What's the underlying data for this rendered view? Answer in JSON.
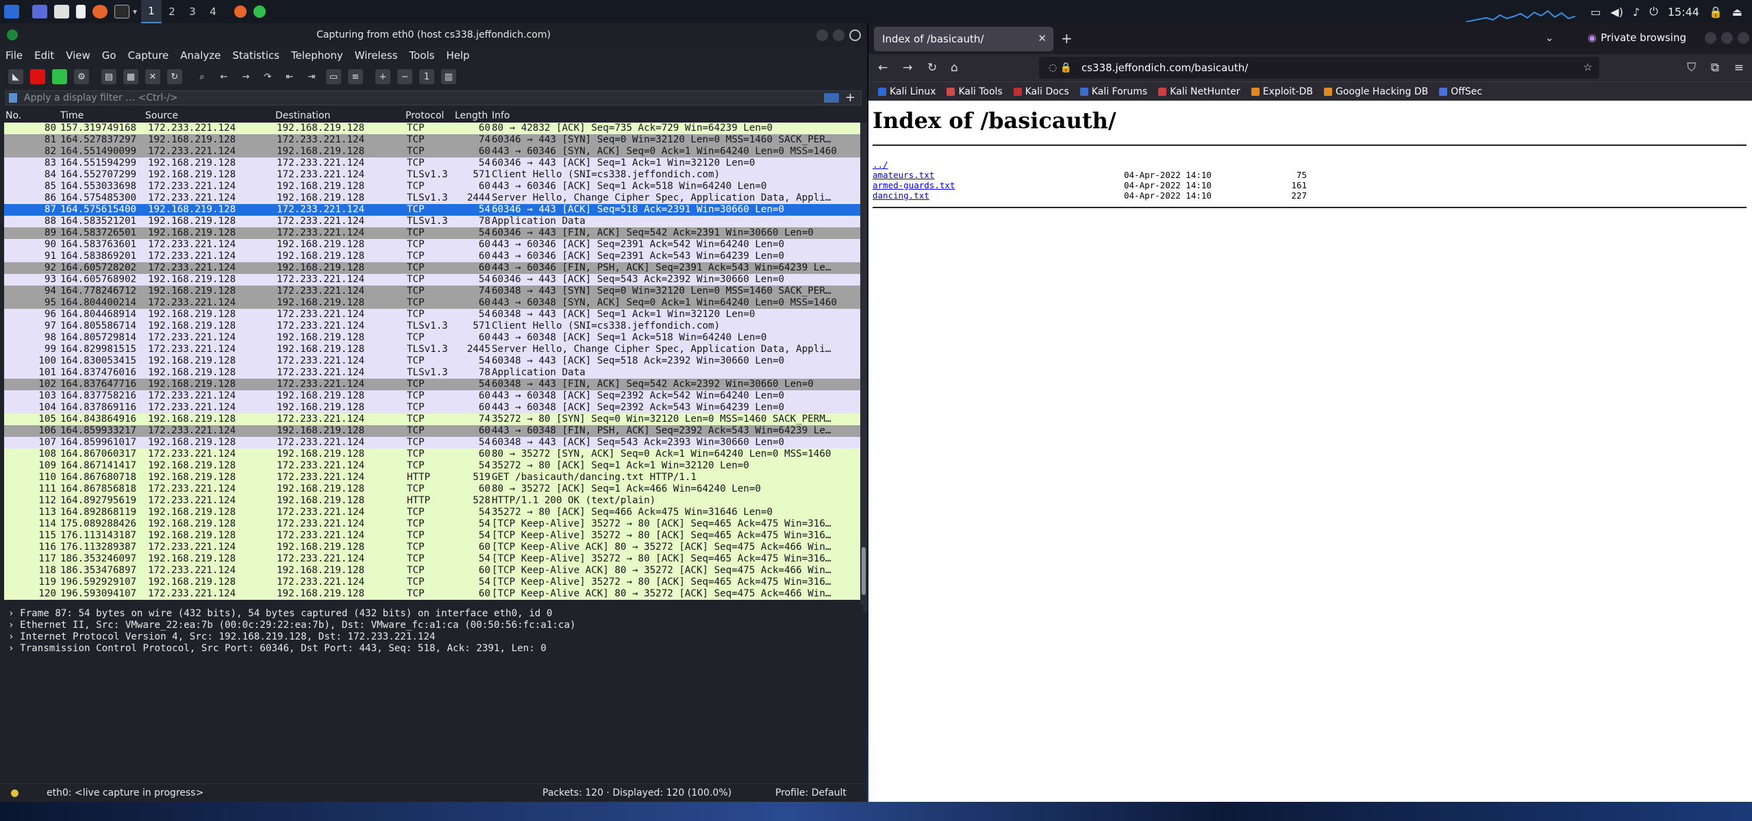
{
  "taskbar": {
    "workspaces": [
      "1",
      "2",
      "3",
      "4"
    ],
    "clock": "15:44"
  },
  "wireshark": {
    "title": "Capturing from eth0 (host cs338.jeffondich.com)",
    "menu": [
      "File",
      "Edit",
      "View",
      "Go",
      "Capture",
      "Analyze",
      "Statistics",
      "Telephony",
      "Wireless",
      "Tools",
      "Help"
    ],
    "filter_placeholder": "Apply a display filter … <Ctrl-/>",
    "columns": [
      "No.",
      "Time",
      "Source",
      "Destination",
      "Protocol",
      "Length",
      "Info"
    ],
    "packets": [
      {
        "no": "80",
        "time": "157.319749168",
        "src": "172.233.221.124",
        "dst": "192.168.219.128",
        "proto": "TCP",
        "len": "60",
        "info": "80 → 42832 [ACK] Seq=735 Ack=729 Win=64239 Len=0",
        "color": "green"
      },
      {
        "no": "81",
        "time": "164.527837297",
        "src": "192.168.219.128",
        "dst": "172.233.221.124",
        "proto": "TCP",
        "len": "74",
        "info": "60346 → 443 [SYN] Seq=0 Win=32120 Len=0 MSS=1460 SACK_PER…",
        "color": "gray"
      },
      {
        "no": "82",
        "time": "164.551490099",
        "src": "172.233.221.124",
        "dst": "192.168.219.128",
        "proto": "TCP",
        "len": "60",
        "info": "443 → 60346 [SYN, ACK] Seq=0 Ack=1 Win=64240 Len=0 MSS=1460",
        "color": "gray"
      },
      {
        "no": "83",
        "time": "164.551594299",
        "src": "192.168.219.128",
        "dst": "172.233.221.124",
        "proto": "TCP",
        "len": "54",
        "info": "60346 → 443 [ACK] Seq=1 Ack=1 Win=32120 Len=0",
        "color": "lav"
      },
      {
        "no": "84",
        "time": "164.552707299",
        "src": "192.168.219.128",
        "dst": "172.233.221.124",
        "proto": "TLSv1.3",
        "len": "571",
        "info": "Client Hello (SNI=cs338.jeffondich.com)",
        "color": "lav"
      },
      {
        "no": "85",
        "time": "164.553033698",
        "src": "172.233.221.124",
        "dst": "192.168.219.128",
        "proto": "TCP",
        "len": "60",
        "info": "443 → 60346 [ACK] Seq=1 Ack=518 Win=64240 Len=0",
        "color": "lav"
      },
      {
        "no": "86",
        "time": "164.575485300",
        "src": "172.233.221.124",
        "dst": "192.168.219.128",
        "proto": "TLSv1.3",
        "len": "2444",
        "info": "Server Hello, Change Cipher Spec, Application Data, Appli…",
        "color": "lav"
      },
      {
        "no": "87",
        "time": "164.575615400",
        "src": "192.168.219.128",
        "dst": "172.233.221.124",
        "proto": "TCP",
        "len": "54",
        "info": "60346 → 443 [ACK] Seq=518 Ack=2391 Win=30660 Len=0",
        "color": "sel"
      },
      {
        "no": "88",
        "time": "164.583521201",
        "src": "192.168.219.128",
        "dst": "172.233.221.124",
        "proto": "TLSv1.3",
        "len": "78",
        "info": "Application Data",
        "color": "lav"
      },
      {
        "no": "89",
        "time": "164.583726501",
        "src": "192.168.219.128",
        "dst": "172.233.221.124",
        "proto": "TCP",
        "len": "54",
        "info": "60346 → 443 [FIN, ACK] Seq=542 Ack=2391 Win=30660 Len=0",
        "color": "gray"
      },
      {
        "no": "90",
        "time": "164.583763601",
        "src": "172.233.221.124",
        "dst": "192.168.219.128",
        "proto": "TCP",
        "len": "60",
        "info": "443 → 60346 [ACK] Seq=2391 Ack=542 Win=64240 Len=0",
        "color": "lav"
      },
      {
        "no": "91",
        "time": "164.583869201",
        "src": "172.233.221.124",
        "dst": "192.168.219.128",
        "proto": "TCP",
        "len": "60",
        "info": "443 → 60346 [ACK] Seq=2391 Ack=543 Win=64239 Len=0",
        "color": "lav"
      },
      {
        "no": "92",
        "time": "164.605728202",
        "src": "172.233.221.124",
        "dst": "192.168.219.128",
        "proto": "TCP",
        "len": "60",
        "info": "443 → 60346 [FIN, PSH, ACK] Seq=2391 Ack=543 Win=64239 Le…",
        "color": "gray"
      },
      {
        "no": "93",
        "time": "164.605768902",
        "src": "192.168.219.128",
        "dst": "172.233.221.124",
        "proto": "TCP",
        "len": "54",
        "info": "60346 → 443 [ACK] Seq=543 Ack=2392 Win=30660 Len=0",
        "color": "lav"
      },
      {
        "no": "94",
        "time": "164.778246712",
        "src": "192.168.219.128",
        "dst": "172.233.221.124",
        "proto": "TCP",
        "len": "74",
        "info": "60348 → 443 [SYN] Seq=0 Win=32120 Len=0 MSS=1460 SACK_PER…",
        "color": "gray"
      },
      {
        "no": "95",
        "time": "164.804400214",
        "src": "172.233.221.124",
        "dst": "192.168.219.128",
        "proto": "TCP",
        "len": "60",
        "info": "443 → 60348 [SYN, ACK] Seq=0 Ack=1 Win=64240 Len=0 MSS=1460",
        "color": "gray"
      },
      {
        "no": "96",
        "time": "164.804468914",
        "src": "192.168.219.128",
        "dst": "172.233.221.124",
        "proto": "TCP",
        "len": "54",
        "info": "60348 → 443 [ACK] Seq=1 Ack=1 Win=32120 Len=0",
        "color": "lav"
      },
      {
        "no": "97",
        "time": "164.805586714",
        "src": "192.168.219.128",
        "dst": "172.233.221.124",
        "proto": "TLSv1.3",
        "len": "571",
        "info": "Client Hello (SNI=cs338.jeffondich.com)",
        "color": "lav"
      },
      {
        "no": "98",
        "time": "164.805729814",
        "src": "172.233.221.124",
        "dst": "192.168.219.128",
        "proto": "TCP",
        "len": "60",
        "info": "443 → 60348 [ACK] Seq=1 Ack=518 Win=64240 Len=0",
        "color": "lav"
      },
      {
        "no": "99",
        "time": "164.829981515",
        "src": "172.233.221.124",
        "dst": "192.168.219.128",
        "proto": "TLSv1.3",
        "len": "2445",
        "info": "Server Hello, Change Cipher Spec, Application Data, Appli…",
        "color": "lav"
      },
      {
        "no": "100",
        "time": "164.830053415",
        "src": "192.168.219.128",
        "dst": "172.233.221.124",
        "proto": "TCP",
        "len": "54",
        "info": "60348 → 443 [ACK] Seq=518 Ack=2392 Win=30660 Len=0",
        "color": "lav"
      },
      {
        "no": "101",
        "time": "164.837476016",
        "src": "192.168.219.128",
        "dst": "172.233.221.124",
        "proto": "TLSv1.3",
        "len": "78",
        "info": "Application Data",
        "color": "lav"
      },
      {
        "no": "102",
        "time": "164.837647716",
        "src": "192.168.219.128",
        "dst": "172.233.221.124",
        "proto": "TCP",
        "len": "54",
        "info": "60348 → 443 [FIN, ACK] Seq=542 Ack=2392 Win=30660 Len=0",
        "color": "gray"
      },
      {
        "no": "103",
        "time": "164.837758216",
        "src": "172.233.221.124",
        "dst": "192.168.219.128",
        "proto": "TCP",
        "len": "60",
        "info": "443 → 60348 [ACK] Seq=2392 Ack=542 Win=64240 Len=0",
        "color": "lav"
      },
      {
        "no": "104",
        "time": "164.837869116",
        "src": "172.233.221.124",
        "dst": "192.168.219.128",
        "proto": "TCP",
        "len": "60",
        "info": "443 → 60348 [ACK] Seq=2392 Ack=543 Win=64239 Len=0",
        "color": "lav"
      },
      {
        "no": "105",
        "time": "164.843864916",
        "src": "192.168.219.128",
        "dst": "172.233.221.124",
        "proto": "TCP",
        "len": "74",
        "info": "35272 → 80 [SYN] Seq=0 Win=32120 Len=0 MSS=1460 SACK_PERM…",
        "color": "green"
      },
      {
        "no": "106",
        "time": "164.859933217",
        "src": "172.233.221.124",
        "dst": "192.168.219.128",
        "proto": "TCP",
        "len": "60",
        "info": "443 → 60348 [FIN, PSH, ACK] Seq=2392 Ack=543 Win=64239 Le…",
        "color": "gray"
      },
      {
        "no": "107",
        "time": "164.859961017",
        "src": "192.168.219.128",
        "dst": "172.233.221.124",
        "proto": "TCP",
        "len": "54",
        "info": "60348 → 443 [ACK] Seq=543 Ack=2393 Win=30660 Len=0",
        "color": "lav"
      },
      {
        "no": "108",
        "time": "164.867060317",
        "src": "172.233.221.124",
        "dst": "192.168.219.128",
        "proto": "TCP",
        "len": "60",
        "info": "80 → 35272 [SYN, ACK] Seq=0 Ack=1 Win=64240 Len=0 MSS=1460",
        "color": "green"
      },
      {
        "no": "109",
        "time": "164.867141417",
        "src": "192.168.219.128",
        "dst": "172.233.221.124",
        "proto": "TCP",
        "len": "54",
        "info": "35272 → 80 [ACK] Seq=1 Ack=1 Win=32120 Len=0",
        "color": "green"
      },
      {
        "no": "110",
        "time": "164.867680718",
        "src": "192.168.219.128",
        "dst": "172.233.221.124",
        "proto": "HTTP",
        "len": "519",
        "info": "GET /basicauth/dancing.txt HTTP/1.1",
        "color": "green"
      },
      {
        "no": "111",
        "time": "164.867856818",
        "src": "172.233.221.124",
        "dst": "192.168.219.128",
        "proto": "TCP",
        "len": "60",
        "info": "80 → 35272 [ACK] Seq=1 Ack=466 Win=64240 Len=0",
        "color": "green"
      },
      {
        "no": "112",
        "time": "164.892795619",
        "src": "172.233.221.124",
        "dst": "192.168.219.128",
        "proto": "HTTP",
        "len": "528",
        "info": "HTTP/1.1 200 OK  (text/plain)",
        "color": "green"
      },
      {
        "no": "113",
        "time": "164.892868119",
        "src": "192.168.219.128",
        "dst": "172.233.221.124",
        "proto": "TCP",
        "len": "54",
        "info": "35272 → 80 [ACK] Seq=466 Ack=475 Win=31646 Len=0",
        "color": "green"
      },
      {
        "no": "114",
        "time": "175.089288426",
        "src": "192.168.219.128",
        "dst": "172.233.221.124",
        "proto": "TCP",
        "len": "54",
        "info": "[TCP Keep-Alive] 35272 → 80 [ACK] Seq=465 Ack=475 Win=316…",
        "color": "green"
      },
      {
        "no": "115",
        "time": "176.113143187",
        "src": "192.168.219.128",
        "dst": "172.233.221.124",
        "proto": "TCP",
        "len": "54",
        "info": "[TCP Keep-Alive] 35272 → 80 [ACK] Seq=465 Ack=475 Win=316…",
        "color": "green"
      },
      {
        "no": "116",
        "time": "176.113289387",
        "src": "172.233.221.124",
        "dst": "192.168.219.128",
        "proto": "TCP",
        "len": "60",
        "info": "[TCP Keep-Alive ACK] 80 → 35272 [ACK] Seq=475 Ack=466 Win…",
        "color": "green"
      },
      {
        "no": "117",
        "time": "186.353246097",
        "src": "192.168.219.128",
        "dst": "172.233.221.124",
        "proto": "TCP",
        "len": "54",
        "info": "[TCP Keep-Alive] 35272 → 80 [ACK] Seq=465 Ack=475 Win=316…",
        "color": "green"
      },
      {
        "no": "118",
        "time": "186.353476897",
        "src": "172.233.221.124",
        "dst": "192.168.219.128",
        "proto": "TCP",
        "len": "60",
        "info": "[TCP Keep-Alive ACK] 80 → 35272 [ACK] Seq=475 Ack=466 Win…",
        "color": "green"
      },
      {
        "no": "119",
        "time": "196.592929107",
        "src": "192.168.219.128",
        "dst": "172.233.221.124",
        "proto": "TCP",
        "len": "54",
        "info": "[TCP Keep-Alive] 35272 → 80 [ACK] Seq=465 Ack=475 Win=316…",
        "color": "green"
      },
      {
        "no": "120",
        "time": "196.593094107",
        "src": "172.233.221.124",
        "dst": "192.168.219.128",
        "proto": "TCP",
        "len": "60",
        "info": "[TCP Keep-Alive ACK] 80 → 35272 [ACK] Seq=475 Ack=466 Win…",
        "color": "green"
      }
    ],
    "details": [
      "Frame 87: 54 bytes on wire (432 bits), 54 bytes captured (432 bits) on interface eth0, id 0",
      "Ethernet II, Src: VMware_22:ea:7b (00:0c:29:22:ea:7b), Dst: VMware_fc:a1:ca (00:50:56:fc:a1:ca)",
      "Internet Protocol Version 4, Src: 192.168.219.128, Dst: 172.233.221.124",
      "Transmission Control Protocol, Src Port: 60346, Dst Port: 443, Seq: 518, Ack: 2391, Len: 0"
    ],
    "status": {
      "interface": "eth0: <live capture in progress>",
      "packets": "Packets: 120 · Displayed: 120 (100.0%)",
      "profile": "Profile: Default"
    }
  },
  "firefox": {
    "tab_title": "Index of /basicauth/",
    "private_label": "Private browsing",
    "url": "cs338.jeffondich.com/basicauth/",
    "bookmarks": [
      "Kali Linux",
      "Kali Tools",
      "Kali Docs",
      "Kali Forums",
      "Kali NetHunter",
      "Exploit-DB",
      "Google Hacking DB",
      "OffSec"
    ],
    "page": {
      "heading": "Index of /basicauth/",
      "parent": "../",
      "files": [
        {
          "name": "amateurs.txt",
          "date": "04-Apr-2022 14:10",
          "size": "75"
        },
        {
          "name": "armed-guards.txt",
          "date": "04-Apr-2022 14:10",
          "size": "161"
        },
        {
          "name": "dancing.txt",
          "date": "04-Apr-2022 14:10",
          "size": "227"
        }
      ]
    }
  },
  "colors": {
    "green": "#e6fbc6",
    "lav": "#e4e1f8",
    "gray": "#a1a1a1",
    "sel": "#1f6fe0"
  }
}
